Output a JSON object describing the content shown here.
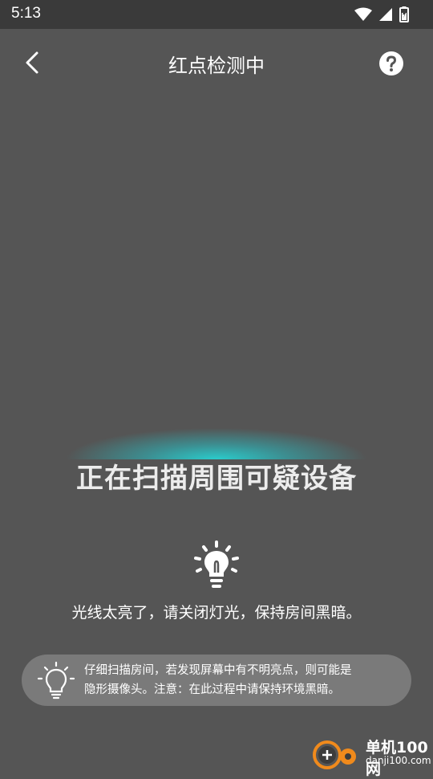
{
  "status_bar": {
    "time": "5:13"
  },
  "header": {
    "title": "红点检测中"
  },
  "scan": {
    "status": "正在扫描周围可疑设备",
    "warning": "光线太亮了，请关闭灯光，保持房间黑暗。"
  },
  "tip": {
    "line1": "仔细扫描房间，若发现屏幕中有不明亮点，则可能是",
    "line2": "隐形摄像头。注意：在此过程中请保持环境黑暗。"
  },
  "watermark": {
    "name": "单机100网",
    "domain": "danji100.com"
  },
  "icons": [
    "back-icon",
    "help-icon",
    "lightbulb-icon",
    "wifi-icon",
    "signal-icon",
    "battery-icon"
  ]
}
